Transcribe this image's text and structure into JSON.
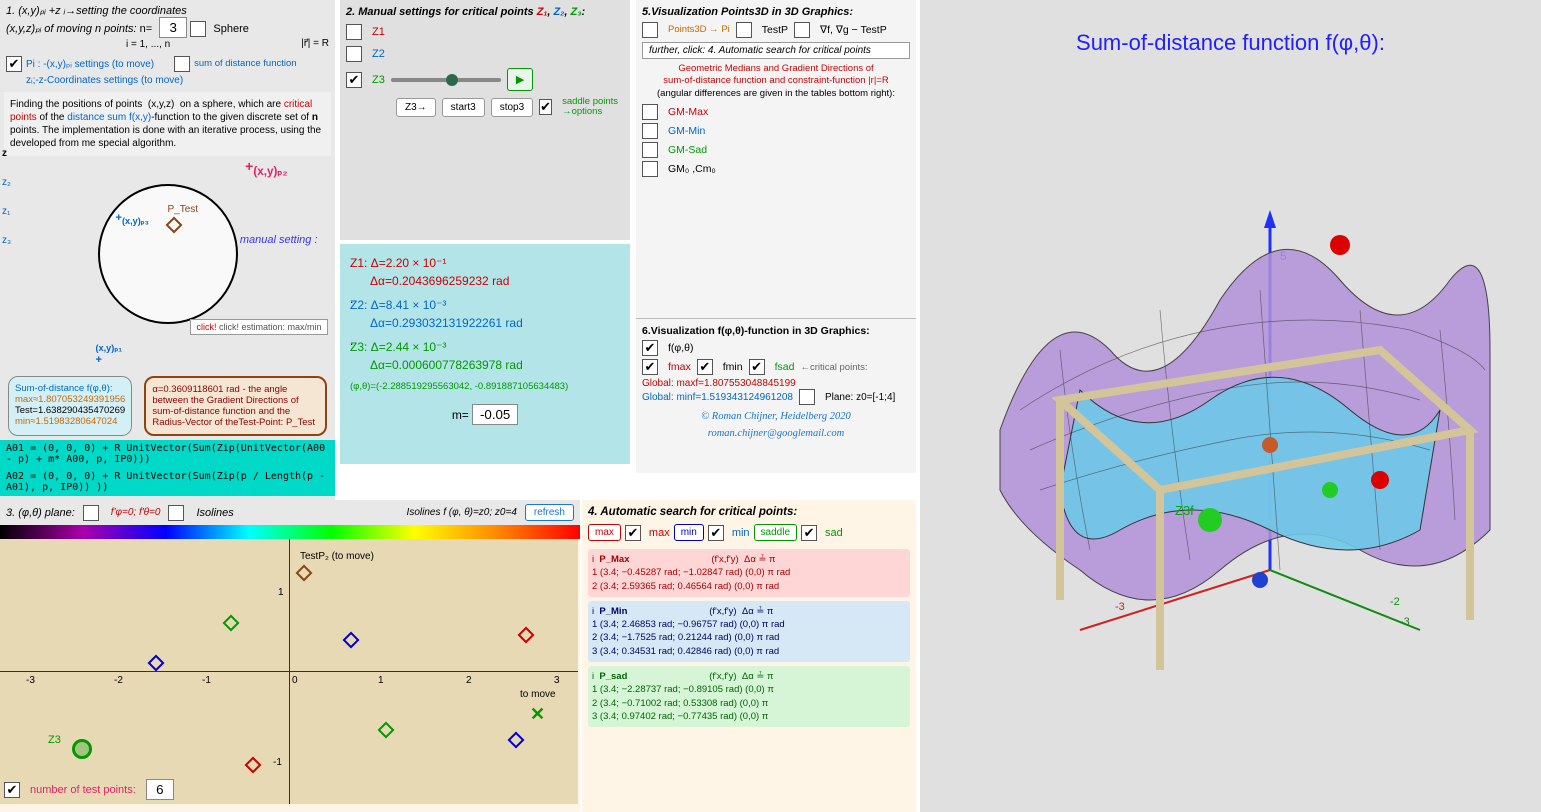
{
  "panel1": {
    "title_a": "1. (x,y)ₚᵢ +z ᵢ→setting the coordinates",
    "title_b": "(x,y,z)ₚᵢ of moving n points:",
    "n_label": "n=",
    "n_value": "3",
    "i_range": "i = 1, ..., n",
    "sphere_label": "Sphere",
    "r_eq": "|r⃗| = R",
    "pi_settings": "Pi : -(x,y)ₚᵢ settings      (to move)",
    "zi_settings": "zᵢ;-z-Coordinates settings (to move)",
    "sum_dist": "sum of distance function",
    "desc": "Finding the positions of points (x,y,z) on a sphere, which are critical points of the distance sum f(x,y)-function to the given discrete set of n points. The implementation is done with an iterative process, using the developed from me special algorithm.",
    "desc_cp": "critical points",
    "pt_p2": "(x,y)ₚ₂",
    "pt_p3": "(x,y)ₚ₃",
    "pt_p1": "(x,y)ₚ₁",
    "ptest": "P_Test",
    "manual_setting": "manual setting :",
    "click_est": "click! estimation: max/min",
    "sumbox_title": "Sum-of-distance f(φ,θ):",
    "sumbox_max": "max≈1.807053249391956",
    "sumbox_test": "Test=1.638290435470269",
    "sumbox_min": "min≈1.51983280647024",
    "alphabox": "α=0.3609118601 rad - the angle between the Gradient Directions of sum-of-distance function and the Radius-Vector of theTest-Point: P_Test",
    "code1": "A01 = (0, 0, 0) + R UnitVector(Sum(Zip(UnitVector(A00 - p) + m* A00, p, IP0)))",
    "code2": "A02 = (0, 0, 0) + R UnitVector(Sum(Zip(p / Length(p - A01), p, IP0)) ))"
  },
  "sidebar": {
    "z": "z",
    "z2": "z₂",
    "z1": "z₁",
    "z3": "z₃"
  },
  "panel2": {
    "title": "2. Manual settings for critical points",
    "z1": "Z1",
    "z2": "Z2",
    "z3": "Z3",
    "z3_btn": "Z3→",
    "start": "start3",
    "stop": "stop3",
    "saddle_opt": "saddle points →options",
    "res_z1a": "Z1: Δ=2.20 × 10⁻¹",
    "res_z1b": "Δα=0.2043696259232   rad",
    "res_z2a": "Z2: Δ=8.41 × 10⁻³",
    "res_z2b": "Δα=0.293032131922261   rad",
    "res_z3a": "Z3: Δ=2.44 × 10⁻³",
    "res_z3b": "Δα=0.000600778263978   rad",
    "phitheta": "(φ,θ)=(-2.288519295563042, -0.891887105634483)",
    "m_label": "m=",
    "m_value": "-0.05"
  },
  "panel5": {
    "title": "5.Visualization Points3D in 3D Graphics:",
    "pts3d": "Points3D → Pi",
    "testp": "TestP",
    "nabla": "∇f, ∇g − TestP",
    "further": "further, click: 4. Automatic search for critical points",
    "desc1": "Geometric Medians  and  Gradient Directions of",
    "desc2": "sum-of-distance function and constraint-function |r|=R",
    "desc3": "(angular differences are given in the tables bottom right):",
    "gm_max": "GM-Max",
    "gm_min": "GM-Min",
    "gm_sad": "GM-Sad",
    "gm0": "GM₀ ,Cm₀"
  },
  "panel6": {
    "title": "6.Visualization f(φ,θ)-function in 3D Graphics:",
    "f": "f(φ,θ)",
    "fmax": "fmax",
    "fmin": "fmin",
    "fsad": "fsad",
    "arrow_cp": "←critical points:",
    "global_max": "Global: maxf=1.807553048845199",
    "global_min": "Global: minf=1.519343124961208",
    "plane": "Plane: z0=[-1;4]",
    "credit1": "©   Roman Chijner, Heidelberg 2020",
    "credit2": "roman.chijner@googlemail.com"
  },
  "panel3": {
    "title": "3. (φ,θ) plane:",
    "fphi": "f'φ=0; f'θ=0",
    "isolines": "Isolines",
    "iso_lbl": "Isolines f (φ, θ)=z0; z0=4",
    "refresh": "refresh",
    "testp2": "TestP₂ (to move)",
    "tomove": "to move",
    "z3": "Z3",
    "ntp_label": "number of test points:",
    "ntp_value": "6",
    "xticks": [
      "-3",
      "-2",
      "-1",
      "0",
      "1",
      "2",
      "3"
    ],
    "yticks": [
      "1",
      "-1"
    ]
  },
  "panel4": {
    "title": "4. Automatic search for critical points:",
    "max": "max",
    "min": "min",
    "sad": "sad",
    "saddle": "saddle",
    "hdr": "i   P        (f'x,f'y)   Δα ≟ π",
    "max_rows": [
      "1   (3.4; −0.45287 rad; −1.02847 rad)   (0,0)   π rad",
      "2   (3.4; 2.59365 rad; 0.46564 rad)     (0,0)   π rad"
    ],
    "min_rows": [
      "1   (3.4; 2.46853 rad; −0.96757 rad)   (0,0)   π rad",
      "2   (3.4; −1.7525 rad; 0.21244 rad)    (0,0)   π rad",
      "3   (3.4; 0.34531 rad; 0.42846 rad)    (0,0)   π rad"
    ],
    "sad_rows": [
      "1   (3.4; −2.28737 rad; −0.89105 rad)  (0,0)   π",
      "2   (3.4; −0.71002 rad; 0.53308 rad)   (0,0)   π",
      "3   (3.4; 0.97402 rad; −0.77435 rad)   (0,0)   π"
    ],
    "pmax": "P_Max",
    "pmin": "P_Min",
    "psad": "P_sad"
  },
  "panel3d": {
    "title": "Sum-of-distance function f(φ,θ):",
    "z3f": "Z3f",
    "axis5": "5",
    "axisn3a": "-3",
    "axisn3b": "-3",
    "axisn2": "-2"
  }
}
